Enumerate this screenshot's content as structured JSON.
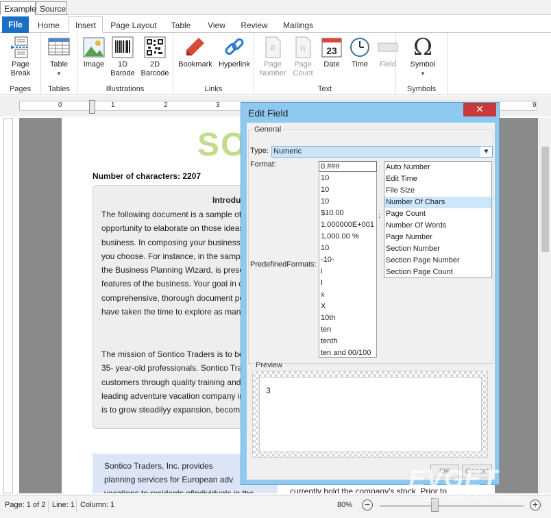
{
  "demo_tabs": [
    "Example",
    "Source"
  ],
  "ribbon_tabs": [
    "File",
    "Home",
    "Insert",
    "Page Layout",
    "Table",
    "View",
    "Review",
    "Mailings"
  ],
  "ribbon": {
    "groups": {
      "pages": "Pages",
      "tables": "Tables",
      "illustrations": "Illustrations",
      "links": "Links",
      "text": "Text",
      "symbols": "Symbols"
    },
    "buttons": {
      "page_break": "Page\nBreak",
      "table": "Table",
      "image": "Image",
      "barcode_1d": "1D\nBarode",
      "barcode_2d": "2D\nBarcode",
      "bookmark": "Bookmark",
      "hyperlink": "Hyperlink",
      "page_number": "Page\nNumber",
      "page_count": "Page\nCount",
      "date": "Date",
      "date_icon_value": "23",
      "time": "Time",
      "field": "Field",
      "symbol": "Symbol"
    }
  },
  "ruler_numbers": [
    "0",
    "1",
    "2",
    "3",
    "9"
  ],
  "document": {
    "logo": "SO",
    "heading": "Number of characters: 2207",
    "box_title": "Introdu",
    "para1": "The following document is a sample of\nopportunity to elaborate on those ideas\nbusiness. In composing your business p\nyou choose. For instance, in the sample\nthe Business Planning Wizard, is prese\nfeatures of the business. Your goal in c\ncomprehensive, thorough document po\nhave taken the time to explore as many",
    "para2": "The mission of Sontico Traders is to be\n35- year-old professionals.  Sontico Tra\ncustomers through quality training and \nleading adventure vacation company in\nis to grow steadilyy expansion, becomin",
    "blue_text": "Sontico   Traders,   Inc.   provides\nplanning  services  for  European  adv\nvacations  to  residents  ofindividuals  in  the",
    "col2_text": "currently  hold  the  company's  stock.  Prior  to"
  },
  "dialog": {
    "title": "Edit Field",
    "close": "✕",
    "general_legend": "General",
    "type_label": "Type:",
    "type_value": "Numeric",
    "format_label": "Format:",
    "format_value": "0.###",
    "predefined_label": "PredefinedFormats:",
    "colon": ":",
    "predefined_formats": [
      "10",
      "10",
      "10",
      "$10.00",
      "1.000000E+001",
      "1,000.00 %",
      "10",
      "-10-",
      "i",
      "I",
      "x",
      "X",
      "10th",
      "ten",
      "tenth",
      "ten and 00/100"
    ],
    "field_types": [
      "Auto Number",
      "Edit Time",
      "File Size",
      "Number Of Chars",
      "Page Count",
      "Number Of Words",
      "Page Number",
      "Section Number",
      "Section Page Number",
      "Section Page Count"
    ],
    "selected_field_type": "Number Of Chars",
    "preview_legend": "Preview",
    "preview_value": "3",
    "ok": "OK",
    "cancel": "Cancel"
  },
  "status": {
    "page": "Page: 1 of 2",
    "line": "Line: 1",
    "column": "Column: 1",
    "zoom": "80%",
    "zoom_level": 0.8
  },
  "watermark": {
    "brand": "EVGET",
    "tagline": "SOFTWARE SOLUTIONS"
  },
  "colors": {
    "file_tab": "#1a6fc6",
    "dialog_frame": "#8ec9f0",
    "close_button": "#c9383a",
    "selected_item": "#cce6fa",
    "logo": "#c4dc8c",
    "blue_block": "#dbe5f5"
  }
}
